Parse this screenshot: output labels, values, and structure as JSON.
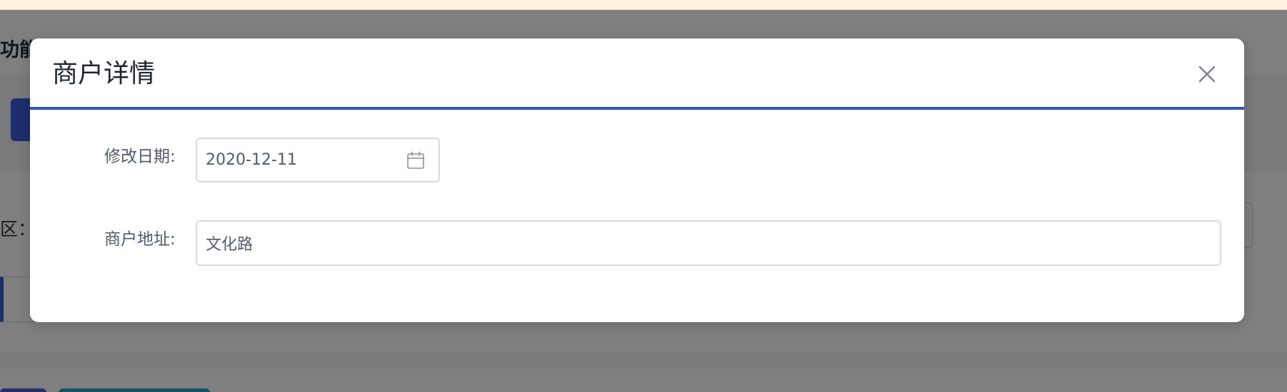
{
  "background": {
    "title_fragment": "功能",
    "filter_label_fragment": "区："
  },
  "modal": {
    "title": "商户详情",
    "close_icon": "close-icon",
    "fields": [
      {
        "label": "修改日期:",
        "value": "2020-12-11",
        "icon": "calendar-icon"
      },
      {
        "label": "商户地址:",
        "value": "文化路"
      }
    ]
  },
  "colors": {
    "accent": "#3352c2",
    "overlay": "rgba(0,0,0,0.5)",
    "warning_strip": "#fdf0dc"
  }
}
